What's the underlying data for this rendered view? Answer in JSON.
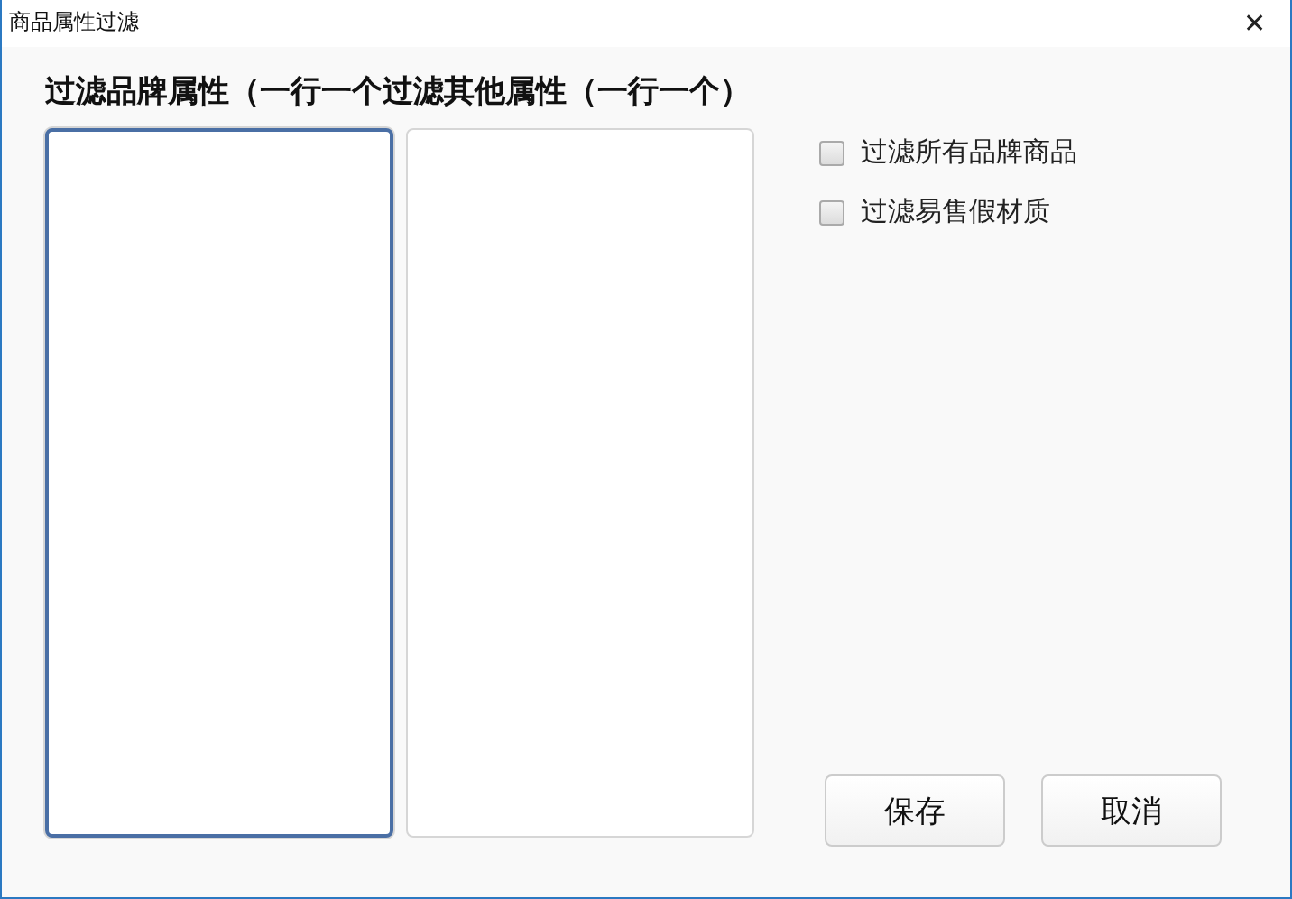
{
  "window": {
    "title": "商品属性过滤",
    "close": "✕"
  },
  "labels": [
    "过滤品牌属性（一行一个",
    "过滤其他属性（一行一个）"
  ],
  "text_areas": [
    {
      "focused": true
    },
    {
      "focused": false
    }
  ],
  "options": [
    {
      "label": "过滤所有品牌商品",
      "checked": false
    },
    {
      "label": "过滤易售假材质",
      "checked": false
    }
  ],
  "buttons": [
    "保存",
    "取消"
  ]
}
